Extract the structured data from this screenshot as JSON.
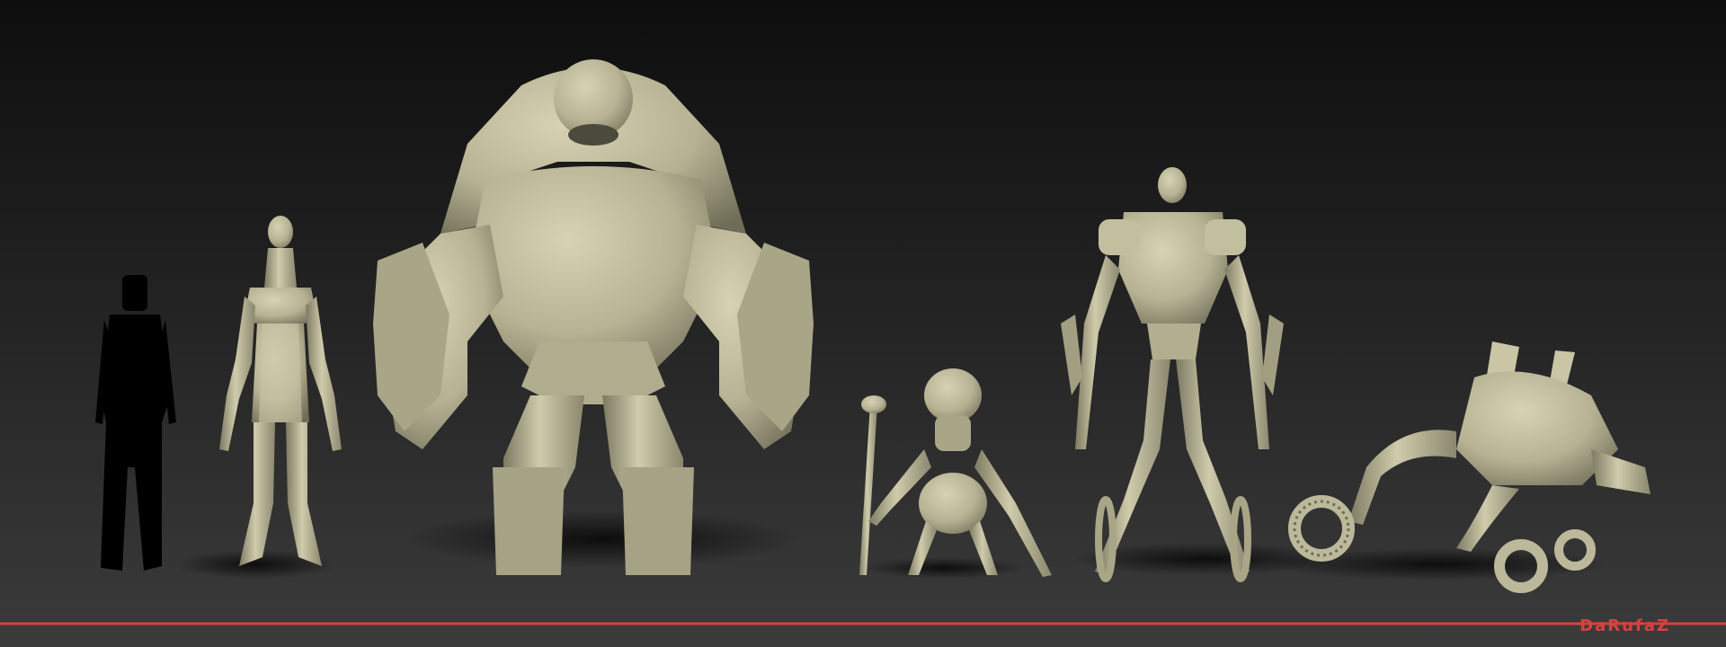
{
  "artist_signature": "DaRufaZ",
  "colors": {
    "background_top": "#0e0e0e",
    "background_bottom": "#3b3b3b",
    "sculpt_material": "#bcb99a",
    "sculpt_shadow": "#6f6c57",
    "silhouette": "#000000",
    "ground_line": "#d8413e"
  },
  "figures": [
    {
      "name": "human-silhouette-reference",
      "kind": "silhouette"
    },
    {
      "name": "slender-alien",
      "kind": "sculpt"
    },
    {
      "name": "hulking-brute",
      "kind": "sculpt"
    },
    {
      "name": "small-staff-creature",
      "kind": "sculpt"
    },
    {
      "name": "armored-blade-mech",
      "kind": "sculpt"
    },
    {
      "name": "crouching-wheel-creature",
      "kind": "sculpt"
    }
  ]
}
